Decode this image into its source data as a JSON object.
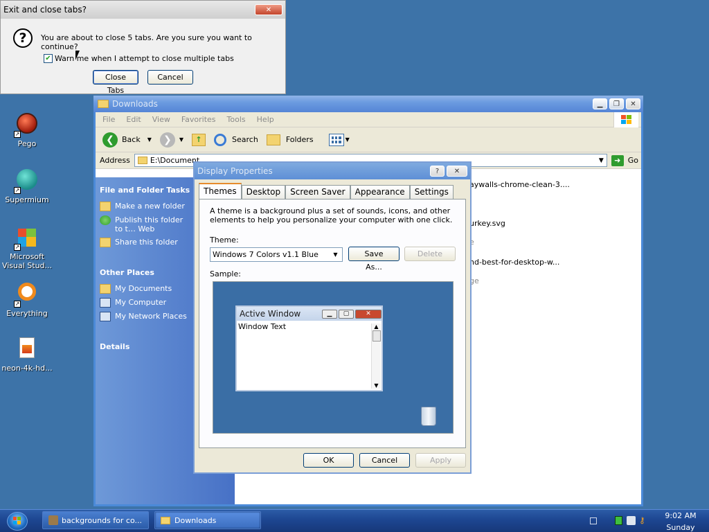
{
  "desktop": {
    "icons": [
      {
        "label": "Pego"
      },
      {
        "label": "Supermium"
      },
      {
        "label": "Microsoft Visual Stud..."
      },
      {
        "label": "Everything"
      },
      {
        "label": "neon-4k-hd..."
      }
    ]
  },
  "exit_dialog": {
    "title": "Exit and close tabs?",
    "message": "You are about to close 5 tabs. Are you sure you want to continue?",
    "checkbox_label": "Warn me when I attempt to close multiple tabs",
    "checkbox_checked": true,
    "close_tabs_label": "Close Tabs",
    "cancel_label": "Cancel"
  },
  "explorer": {
    "title": "Downloads",
    "menu": [
      "File",
      "Edit",
      "View",
      "Favorites",
      "Tools",
      "Help"
    ],
    "toolbar": {
      "back": "Back",
      "search": "Search",
      "folders": "Folders"
    },
    "address_label": "Address",
    "address_value": "E:\\Document",
    "go_label": "Go",
    "tasks": {
      "file_folder_heading": "File and Folder Tasks",
      "file_folder_items": [
        "Make a new folder",
        "Publish this folder to t… Web",
        "Share this folder"
      ],
      "other_places_heading": "Other Places",
      "other_places_items": [
        "My Documents",
        "My Computer",
        "My Network Places"
      ],
      "details_heading": "Details"
    },
    "files": [
      "aywalls-chrome-clean-3....",
      "urkey.svg",
      "e",
      "nd-best-for-desktop-w...",
      "ge"
    ]
  },
  "display_properties": {
    "title": "Display Properties",
    "tabs": [
      "Themes",
      "Desktop",
      "Screen Saver",
      "Appearance",
      "Settings"
    ],
    "description": "A theme is a background plus a set of sounds, icons, and other elements to help you personalize your computer with one click.",
    "theme_label": "Theme:",
    "theme_value": "Windows 7 Colors v1.1 Blue",
    "save_as_label": "Save As...",
    "delete_label": "Delete",
    "sample_label": "Sample:",
    "sample_window_title": "Active Window",
    "sample_window_text": "Window Text",
    "ok_label": "OK",
    "cancel_label": "Cancel",
    "apply_label": "Apply"
  },
  "taskbar": {
    "buttons": [
      "backgrounds for co...",
      "Downloads"
    ],
    "time": "9:02 AM",
    "day": "Sunday"
  }
}
